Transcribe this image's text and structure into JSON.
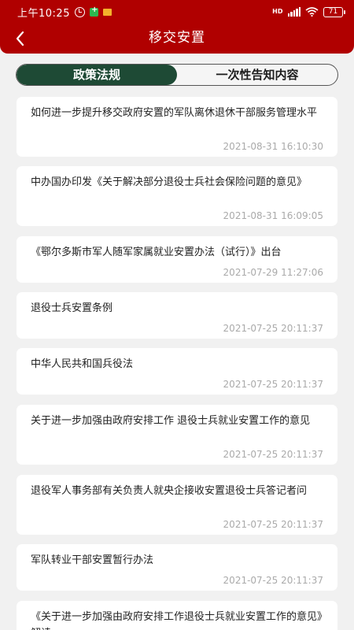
{
  "status_bar": {
    "time": "上午10:25",
    "hd": "HD",
    "battery": "71"
  },
  "header": {
    "title": "移交安置",
    "back_icon": "chevron-left-icon"
  },
  "tabs": [
    {
      "label": "政策法规",
      "active": true
    },
    {
      "label": "一次性告知内容",
      "active": false
    }
  ],
  "articles": [
    {
      "title": "如何进一步提升移交政府安置的军队离休退休干部服务管理水平",
      "time": "2021-08-31 16:10:30"
    },
    {
      "title": "中办国办印发《关于解决部分退役士兵社会保险问题的意见》",
      "time": "2021-08-31 16:09:05"
    },
    {
      "title": "《鄂尔多斯市军人随军家属就业安置办法（试行）》出台",
      "time": "2021-07-29 11:27:06"
    },
    {
      "title": "退役士兵安置条例",
      "time": "2021-07-25 20:11:37"
    },
    {
      "title": "中华人民共和国兵役法",
      "time": "2021-07-25 20:11:37"
    },
    {
      "title": "关于进一步加强由政府安排工作 退役士兵就业安置工作的意见",
      "time": "2021-07-25 20:11:37"
    },
    {
      "title": "退役军人事务部有关负责人就央企接收安置退役士兵答记者问",
      "time": "2021-07-25 20:11:37"
    },
    {
      "title": "军队转业干部安置暂行办法",
      "time": "2021-07-25 20:11:37"
    },
    {
      "title": "《关于进一步加强由政府安排工作退役士兵就业安置工作的意见》解读",
      "time": ""
    }
  ],
  "colors": {
    "header_red": "#b00000",
    "tab_active": "#1e4a35",
    "background": "#f1f1f1"
  }
}
